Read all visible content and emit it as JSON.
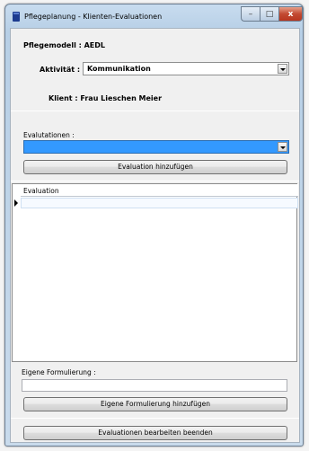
{
  "window": {
    "title": "Pflegeplanung - Klienten-Evaluationen",
    "minimize_glyph": "–",
    "maximize_glyph": "□",
    "close_glyph": "x"
  },
  "form": {
    "pflegemodell_label": "Pflegemodell : AEDL",
    "aktivitaet_label": "Aktivität :",
    "aktivitaet_value": "Kommunikation",
    "klient_label": "Klient : Frau Lieschen Meier",
    "evaluationen_label": "Evalutationen :",
    "evaluation_add_button": "Evaluation hinzufügen",
    "grid_column_header": "Evaluation",
    "eigene_label": "Eigene Formulierung :",
    "eigene_value": "",
    "eigene_add_button": "Eigene Formulierung hinzufügen",
    "finish_button": "Evaluationen bearbeiten beenden"
  },
  "colors": {
    "selection_blue": "#3399ff",
    "title_bar": "#c8dcef",
    "close_red": "#c24a32"
  },
  "icons": {
    "app": "app-icon",
    "dropdown": "chevron-down-icon",
    "row_pointer": "row-pointer-icon"
  }
}
